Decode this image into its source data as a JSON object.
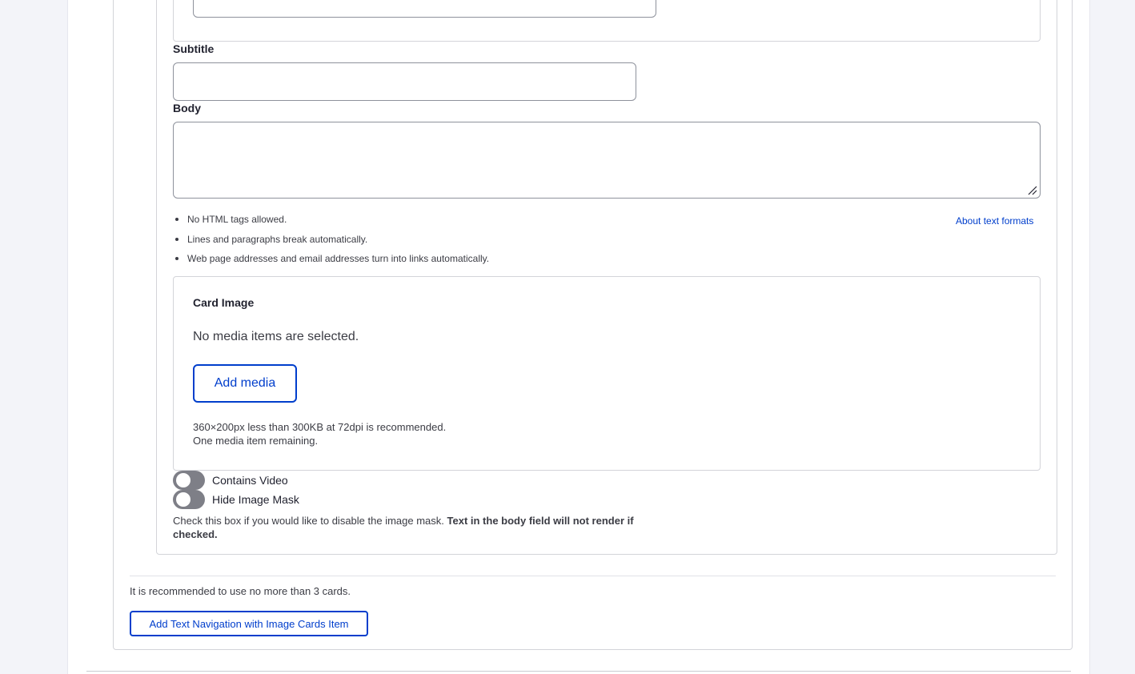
{
  "subtitle_field": {
    "label": "Subtitle",
    "value": ""
  },
  "body_field": {
    "label": "Body",
    "value": ""
  },
  "text_format": {
    "tips": [
      "No HTML tags allowed.",
      "Lines and paragraphs break automatically.",
      "Web page addresses and email addresses turn into links automatically."
    ],
    "about_link": "About text formats"
  },
  "card_image": {
    "title": "Card Image",
    "empty_message": "No media items are selected.",
    "add_media_label": "Add media",
    "recommendation": "360×200px less than 300KB at 72dpi is recommended.",
    "remaining": "One media item remaining."
  },
  "toggles": {
    "contains_video": {
      "label": "Contains Video",
      "checked": false
    },
    "hide_image_mask": {
      "label": "Hide Image Mask",
      "checked": false
    }
  },
  "mask_description": {
    "text": "Check this box if you would like to disable the image mask. ",
    "bold": "Text in the body field will not render if checked."
  },
  "footer": {
    "recommendation": "It is recommended to use no more than 3 cards.",
    "add_item_label": "Add Text Navigation with Image Cards Item"
  },
  "colors": {
    "accent": "#003ecc",
    "toggle_off": "#7e7f87",
    "border": "#d3d4d9"
  }
}
